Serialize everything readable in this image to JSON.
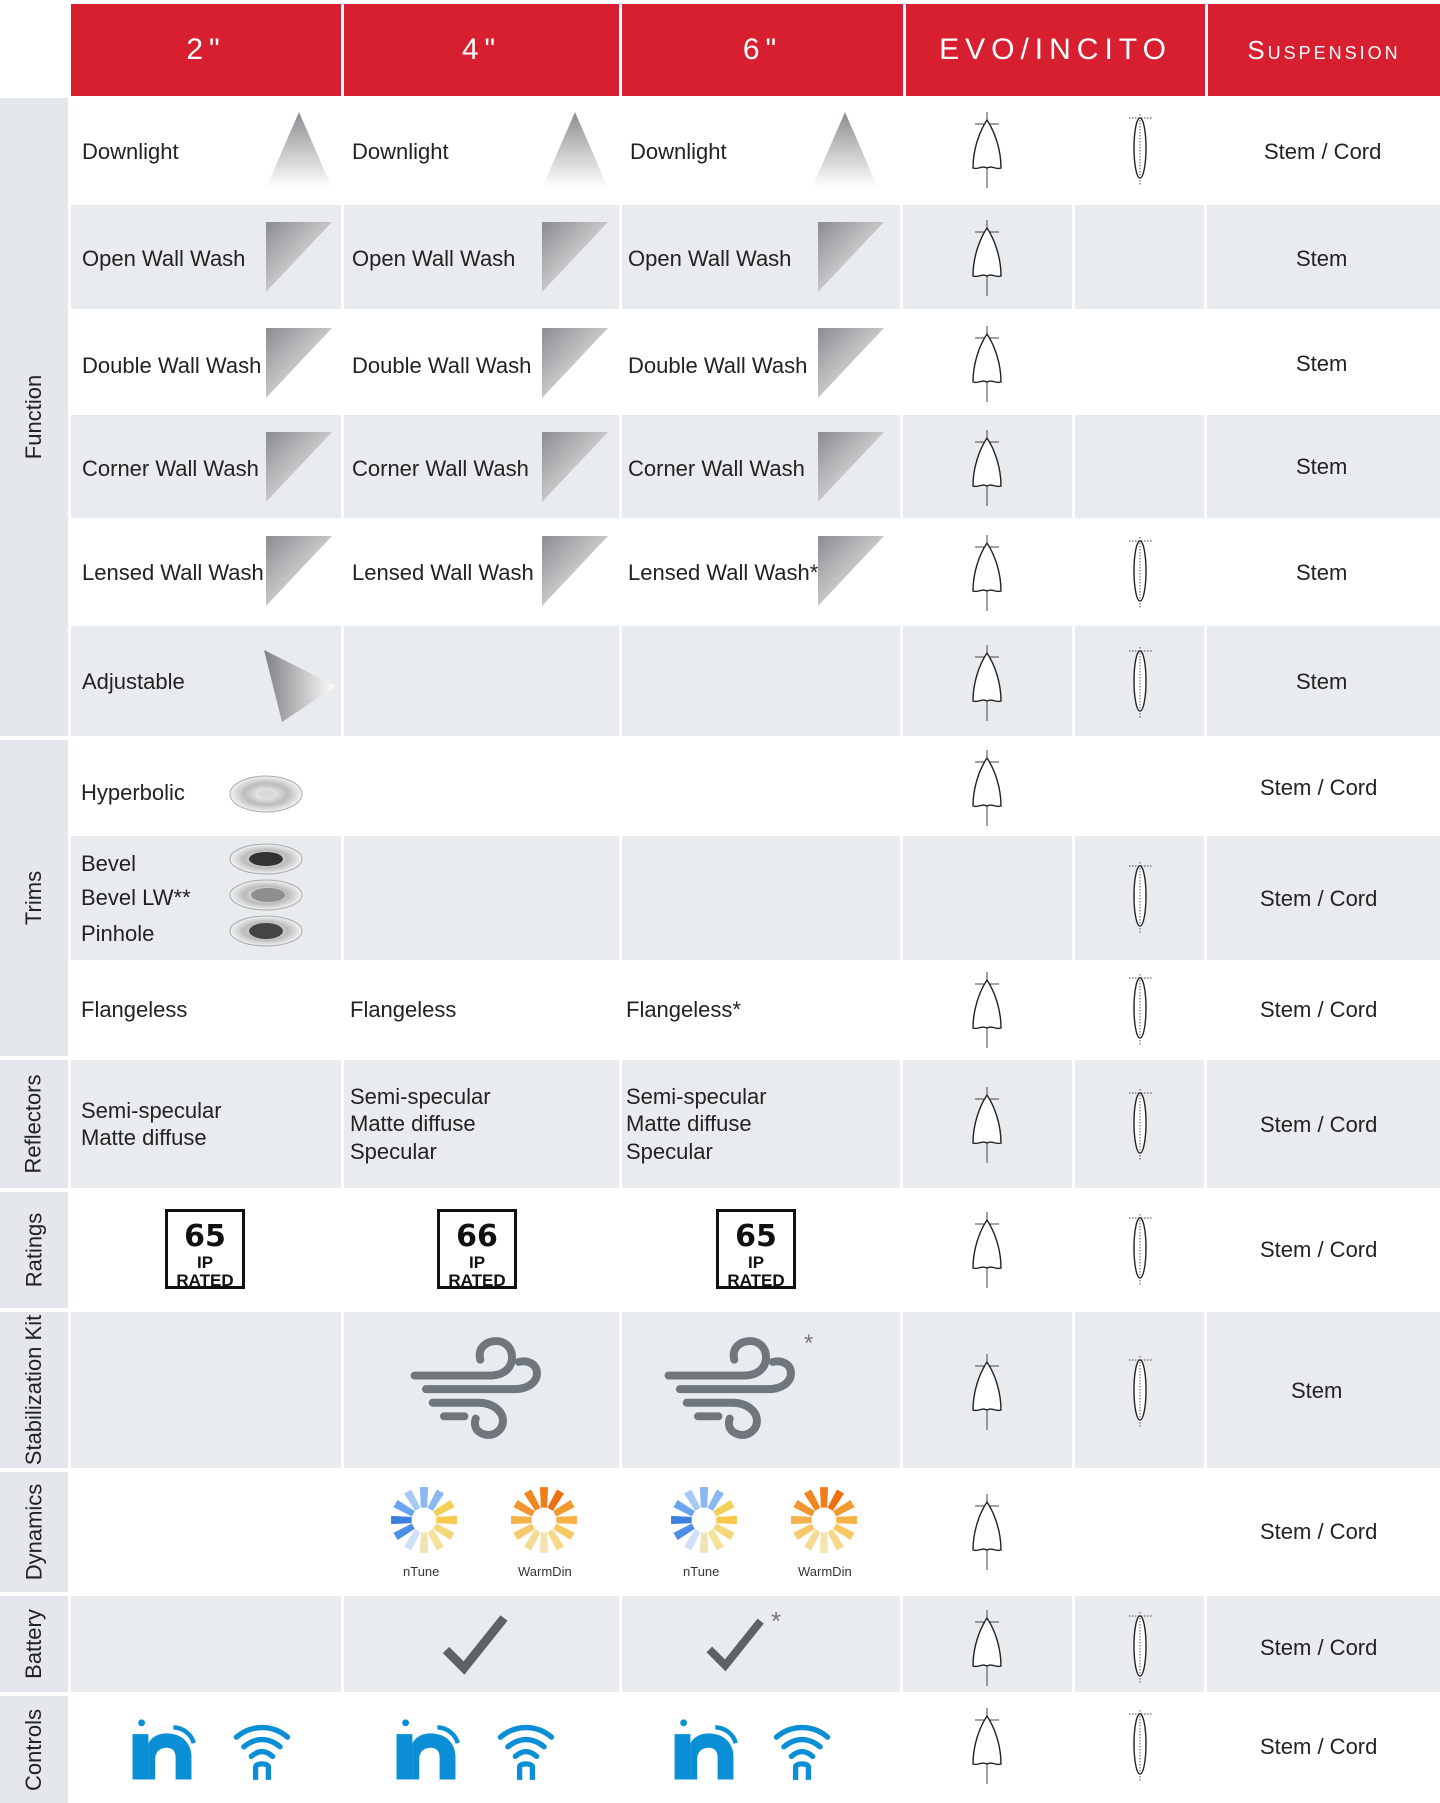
{
  "headers": {
    "col_2in": "2\"",
    "col_4in": "4\"",
    "col_6in": "6\"",
    "col_evo": "EVO/INCITO",
    "col_suspension": "Suspension"
  },
  "sections": {
    "function": "Function",
    "trims": "Trims",
    "reflectors": "Reflectors",
    "ratings": "Ratings",
    "stabilization": "Stabilization Kit",
    "dynamics": "Dynamics",
    "battery": "Battery",
    "controls": "Controls"
  },
  "function_rows": [
    {
      "c2": "Downlight",
      "c4": "Downlight",
      "c6": "Downlight",
      "suspension": "Stem / Cord"
    },
    {
      "c2": "Open Wall Wash",
      "c4": "Open Wall Wash",
      "c6": "Open Wall Wash",
      "suspension": "Stem"
    },
    {
      "c2": "Double Wall Wash",
      "c4": "Double Wall Wash",
      "c6": "Double Wall Wash",
      "suspension": "Stem"
    },
    {
      "c2": "Corner Wall Wash",
      "c4": "Corner Wall Wash",
      "c6": "Corner Wall Wash",
      "suspension": "Stem"
    },
    {
      "c2": "Lensed Wall Wash",
      "c4": "Lensed Wall Wash",
      "c6": "Lensed Wall Wash*",
      "suspension": "Stem"
    },
    {
      "c2": "Adjustable",
      "c4": "",
      "c6": "",
      "suspension": "Stem"
    }
  ],
  "trims": {
    "hyperbolic": "Hyperbolic",
    "hyperbolic_susp": "Stem / Cord",
    "bevel": "Bevel",
    "bevel_lw": "Bevel LW**",
    "pinhole": "Pinhole",
    "bevel_susp": "Stem / Cord",
    "flangeless_2": "Flangeless",
    "flangeless_4": "Flangeless",
    "flangeless_6": "Flangeless*",
    "flangeless_susp": "Stem / Cord"
  },
  "reflectors": {
    "c2_line1": "Semi-specular",
    "c2_line2": "Matte diffuse",
    "c4_line1": "Semi-specular",
    "c4_line2": "Matte diffuse",
    "c4_line3": "Specular",
    "c6_line1": "Semi-specular",
    "c6_line2": "Matte diffuse",
    "c6_line3": "Specular",
    "susp": "Stem / Cord"
  },
  "ratings": {
    "c2_num": "65",
    "c4_num": "66",
    "c6_num": "65",
    "caption": "IP RATED",
    "susp": "Stem / Cord"
  },
  "stabilization": {
    "c6_mark": "*",
    "susp": "Stem"
  },
  "dynamics": {
    "ntune": "nTune",
    "warmdin": "WarmDin",
    "susp": "Stem / Cord"
  },
  "battery": {
    "c6_mark": "*",
    "susp": "Stem / Cord"
  },
  "controls": {
    "susp": "Stem / Cord"
  },
  "colors": {
    "header_red": "#d71f30",
    "band_gray": "#e9ecee",
    "side_gray": "#e4e7eb",
    "control_blue": "#0a8fd6",
    "wind_gray": "#6f767c",
    "check_gray": "#5c6266"
  }
}
